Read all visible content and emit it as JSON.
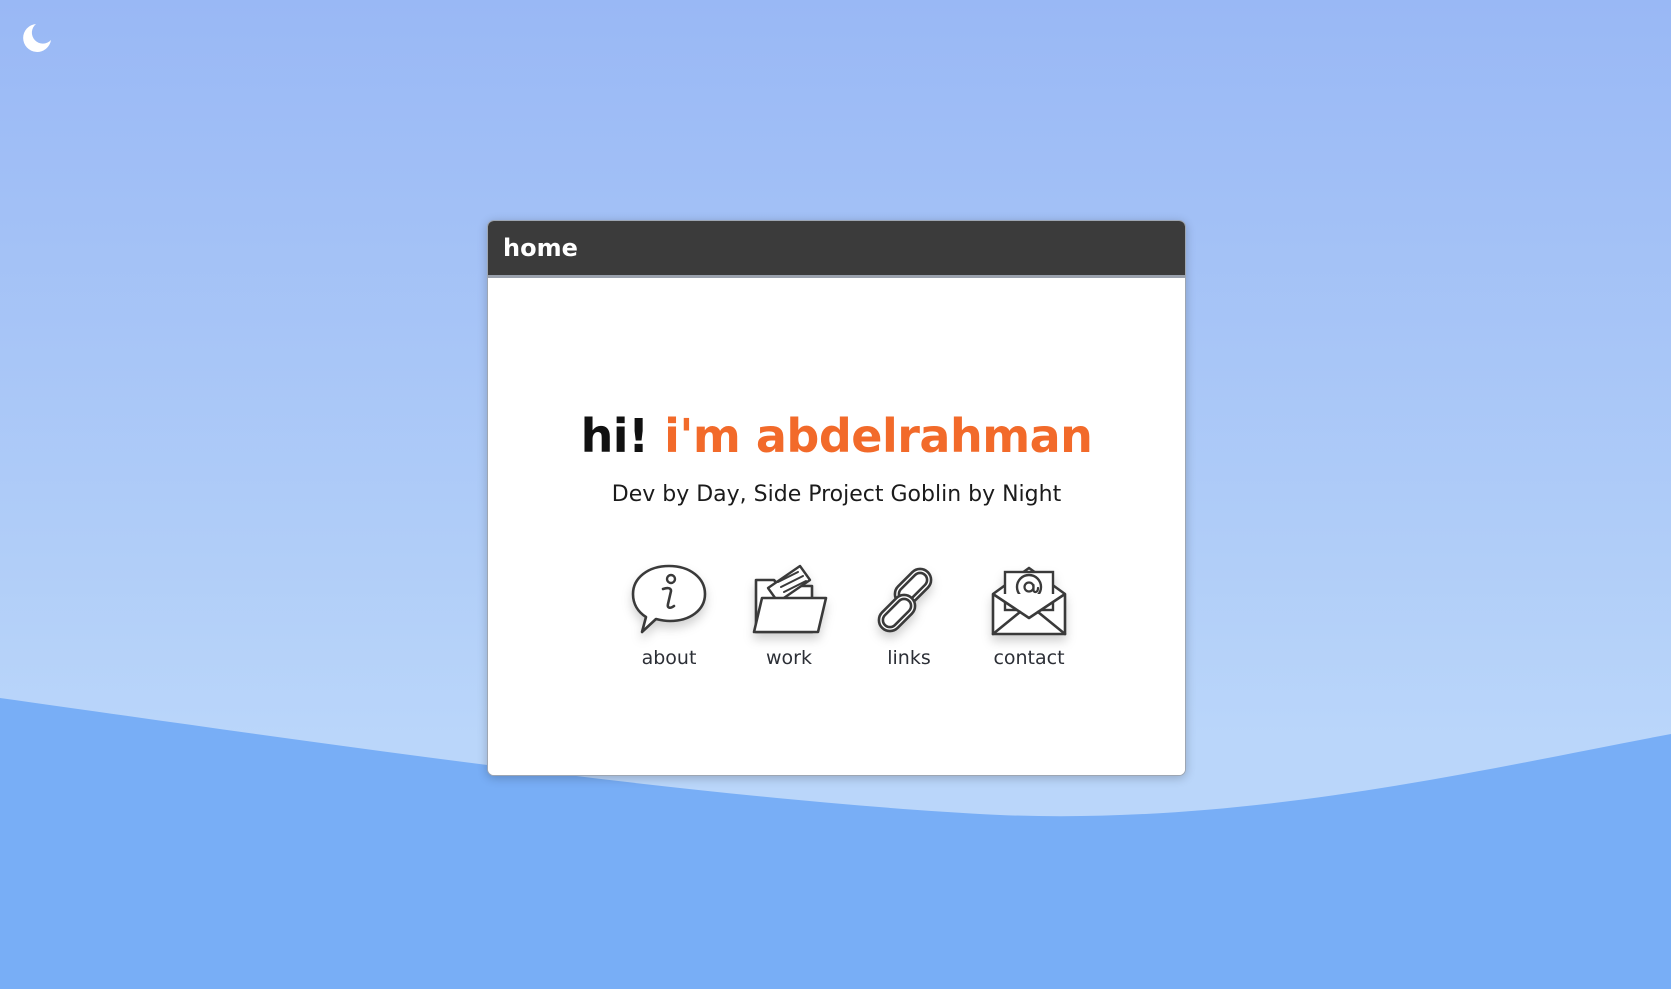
{
  "theme_toggle": {
    "icon": "moon-icon"
  },
  "window": {
    "title": "home",
    "headline": {
      "greeting": "hi!",
      "name": "i'm abdelrahman"
    },
    "tagline": "Dev by Day, Side Project Goblin by Night",
    "nav": [
      {
        "label": "about",
        "icon": "info-speech-bubble-icon"
      },
      {
        "label": "work",
        "icon": "folder-icon"
      },
      {
        "label": "links",
        "icon": "chain-link-icon"
      },
      {
        "label": "contact",
        "icon": "envelope-icon"
      }
    ]
  },
  "colors": {
    "sky_top": "#99b8f5",
    "sky_bottom": "#bad6fa",
    "wave": "#78aef6",
    "titlebar": "#3b3b3b",
    "accent": "#f26a2a"
  }
}
